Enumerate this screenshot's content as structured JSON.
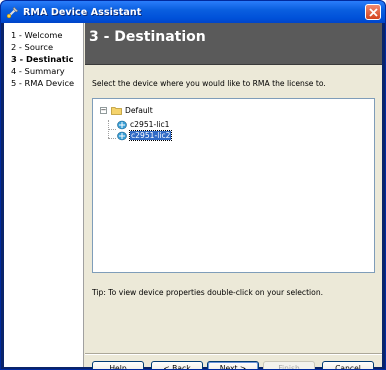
{
  "window": {
    "title": "RMA Device Assistant"
  },
  "steps": [
    {
      "label": "1 - Welcome"
    },
    {
      "label": "2 - Source"
    },
    {
      "label": "3 - Destinatic"
    },
    {
      "label": "4 - Summary"
    },
    {
      "label": "5 - RMA Device"
    }
  ],
  "active_step": 3,
  "header": {
    "title": "3 - Destination"
  },
  "instruction": "Select the device where you would like to RMA the license to.",
  "tree": {
    "root": {
      "label": "Default",
      "expander": "−"
    },
    "children": [
      {
        "label": "c2951-lic1",
        "selected": false
      },
      {
        "label": "c2951-lic2",
        "selected": true
      }
    ]
  },
  "tip": "Tip: To view device properties double-click on your selection.",
  "buttons": {
    "help": "Help",
    "back": "< Back",
    "next": "Next >",
    "finish": "Finish",
    "cancel": "Cancel"
  },
  "colors": {
    "titlebar": "#0a5fe0",
    "header_bg": "#5a5a5a",
    "selection": "#316ac5"
  }
}
